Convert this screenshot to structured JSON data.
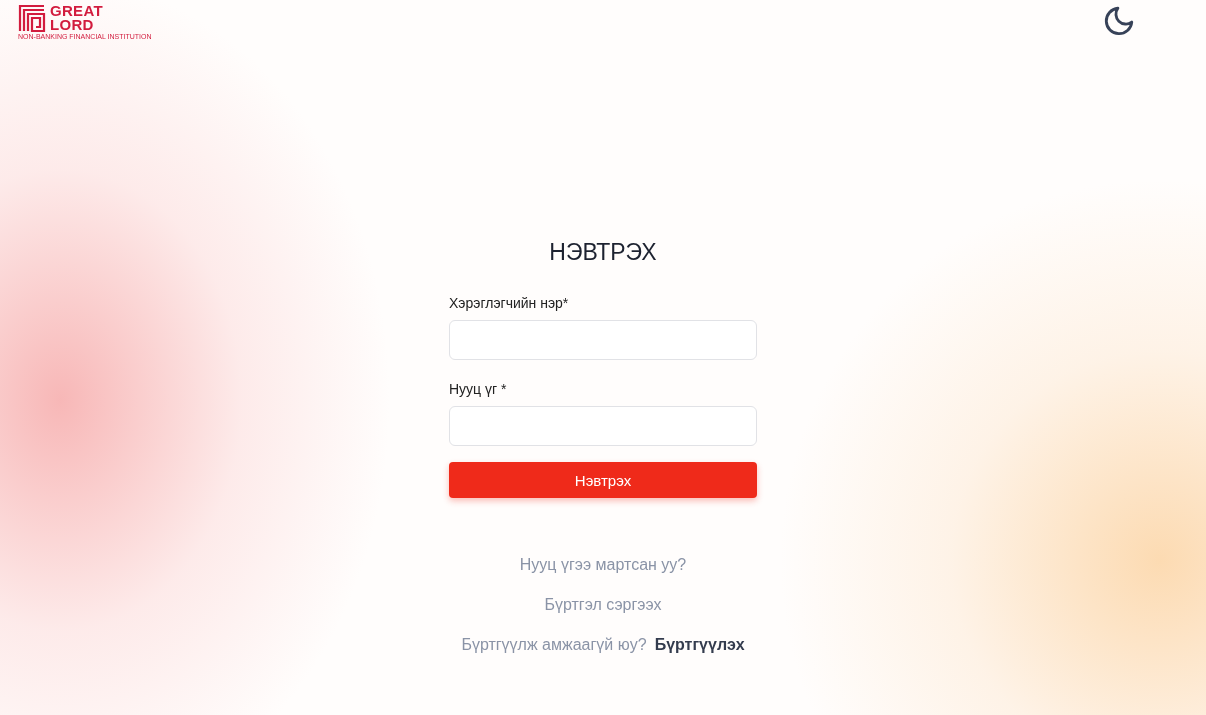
{
  "logo": {
    "name_line_1": "GREAT",
    "name_line_2": "LORD",
    "tagline": "NON-BANKING FINANCIAL INSTITUTION"
  },
  "title": "НЭВТРЭХ",
  "fields": [
    {
      "label": "Хэрэглэгчийн нэр*"
    },
    {
      "label": "Нууц үг *"
    }
  ],
  "submit_button": "Нэвтрэх",
  "links": [
    {
      "text": "Нууц үгээ мартсан уу?"
    },
    {
      "text": "Бүртгэл сэргээх"
    }
  ],
  "signup": {
    "question": "Бүртгүүлж амжаагүй юу?",
    "link": "Бүртгүүлэх"
  }
}
